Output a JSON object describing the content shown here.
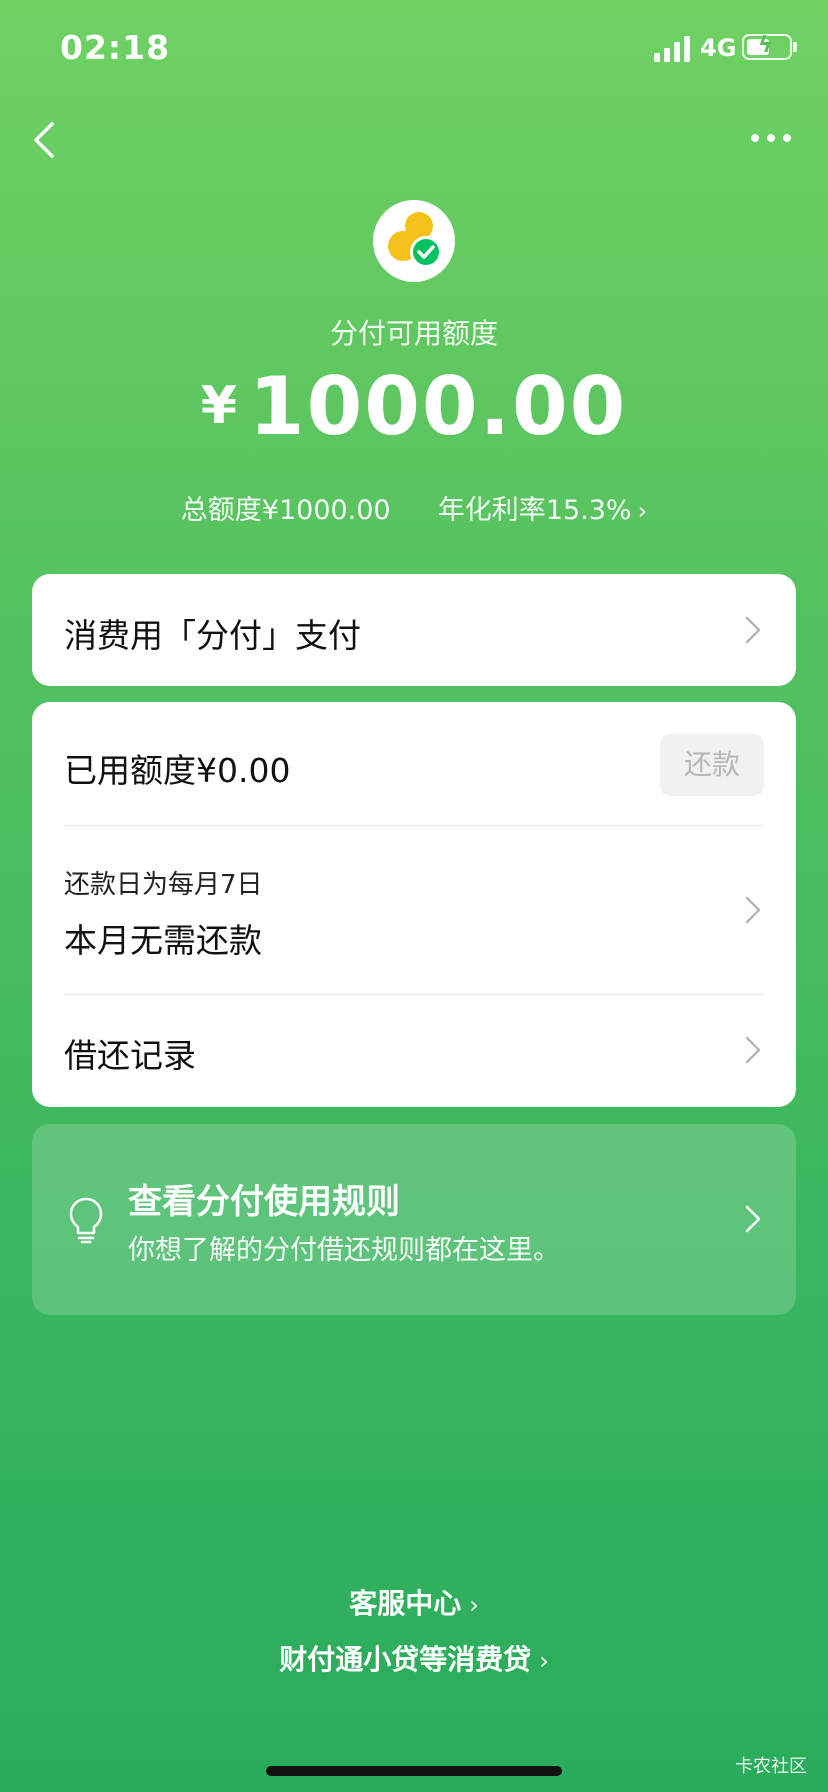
{
  "status_bar": {
    "time": "02:18",
    "network": "4G"
  },
  "header": {
    "back_icon": "back-chevron-icon",
    "more_icon": "more-dots-icon"
  },
  "hero": {
    "subtitle": "分付可用额度",
    "currency": "¥",
    "amount": "1000.00",
    "total_limit": "总额度¥1000.00",
    "annual_rate": "年化利率15.3%"
  },
  "card_pay": {
    "label": "消费用「分付」支付"
  },
  "card_usage": {
    "used_label": "已用额度¥0.00",
    "repay_button": "还款",
    "due_caption": "还款日为每月7日",
    "due_status": "本月无需还款",
    "records_label": "借还记录"
  },
  "rules_banner": {
    "title": "查看分付使用规则",
    "description": "你想了解的分付借还规则都在这里。",
    "icon": "lightbulb-icon"
  },
  "footer": {
    "customer_service": "客服中心",
    "consumer_loan": "财付通小贷等消费贷"
  },
  "watermark": "卡农社区",
  "colors": {
    "accent_green": "#07c160",
    "logo_yellow": "#f4c21a"
  }
}
